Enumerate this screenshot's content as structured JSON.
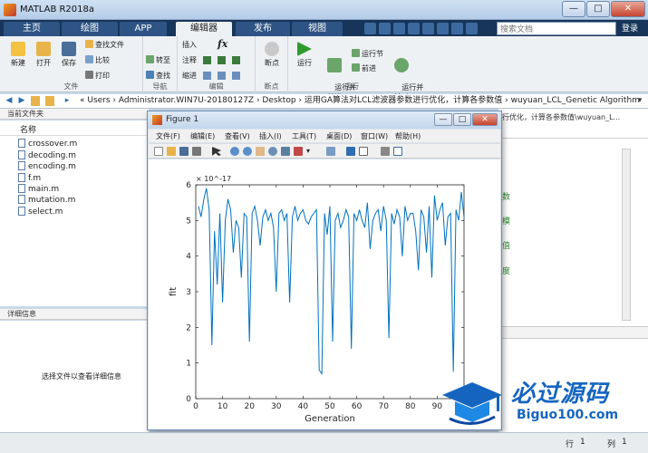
{
  "window": {
    "title": "MATLAB R2018a",
    "minimize": "—",
    "maximize": "□",
    "close": "✕"
  },
  "tabs": [
    "主页",
    "绘图",
    "APP",
    "编辑器",
    "发布",
    "视图"
  ],
  "active_tab": "编辑器",
  "search": {
    "placeholder": "搜索文档"
  },
  "login_label": "登录",
  "ribbon": {
    "file_group": {
      "label": "文件",
      "new": "新建",
      "open": "打开",
      "save": "保存",
      "find_files": "查找文件",
      "compare": "比较",
      "print": "打印"
    },
    "nav_group": {
      "label": "导航",
      "goto": "转至",
      "find": "查找"
    },
    "edit_group": {
      "label": "编辑",
      "insert": "插入",
      "comment": "注释",
      "indent": "缩进",
      "fx": "fx"
    },
    "breakpoint_group": {
      "label": "断点",
      "breakpoint": "断点"
    },
    "run_group": {
      "label": "运行",
      "run": "运行",
      "run_advance": "运行并\n前进",
      "run_section": "运行节",
      "advance": "前进",
      "run_time": "运行并\n计时"
    }
  },
  "address": {
    "path": "«  Users  ›  Administrator.WIN7U-20180127Z  ›  Desktop  ›  运用GA算法对LCL滤波器参数进行优化，计算各参数值  ›  wuyuan_LCL_Genetic Algorithm"
  },
  "file_browser": {
    "header": "当前文件夹",
    "column": "名称",
    "files": [
      "crossover.m",
      "decoding.m",
      "encoding.m",
      "f.m",
      "main.m",
      "mutation.m",
      "select.m"
    ]
  },
  "detail": {
    "header": "详细信息",
    "message": "选择文件以查看详细信息"
  },
  "right_panel": {
    "truncated_title": "行优化，计算各参数值\\wuyuan_L...",
    "snippets": [
      "数",
      "模",
      "值",
      "度"
    ]
  },
  "figure": {
    "title": "Figure 1",
    "menu": [
      "文件(F)",
      "编辑(E)",
      "查看(V)",
      "插入(I)",
      "工具(T)",
      "桌面(D)",
      "窗口(W)",
      "帮助(H)"
    ]
  },
  "status_bar": {
    "row_label": "行",
    "row_value": "1",
    "col_label": "列",
    "col_value": "1"
  },
  "watermark": {
    "text": "必过源码",
    "url": "Biguo100.com"
  },
  "chart_data": {
    "type": "line",
    "xlabel": "Generation",
    "ylabel": "fit",
    "exponent_label": "× 10^-17",
    "xlim": [
      0,
      100
    ],
    "ylim": [
      0,
      6
    ],
    "xticks": [
      0,
      10,
      20,
      30,
      40,
      50,
      60,
      70,
      80,
      90
    ],
    "yticks": [
      0,
      1,
      2,
      3,
      4,
      5,
      6
    ],
    "color": "#0072BD",
    "series": [
      {
        "values": [
          5.4,
          5.1,
          5.6,
          5.9,
          5.3,
          1.5,
          4.7,
          3.2,
          5.2,
          2.7,
          5.0,
          5.6,
          5.3,
          4.1,
          5.0,
          4.8,
          3.4,
          5.2,
          5.1,
          1.6,
          5.2,
          5.4,
          5.0,
          4.3,
          5.1,
          5.3,
          5.0,
          5.2,
          4.8,
          3.0,
          5.2,
          5.3,
          5.0,
          5.2,
          2.7,
          5.1,
          5.4,
          5.0,
          5.2,
          5.3,
          5.0,
          4.9,
          5.1,
          5.2,
          5.3,
          0.8,
          0.7,
          5.2,
          4.6,
          5.4,
          1.6,
          5.0,
          5.2,
          4.8,
          5.0,
          5.3,
          5.1,
          1.4,
          5.2,
          5.0,
          5.3,
          5.0,
          4.8,
          5.5,
          4.2,
          5.0,
          5.2,
          5.3,
          4.7,
          5.4,
          5.0,
          1.7,
          5.2,
          4.9,
          5.3,
          5.1,
          4.0,
          5.4,
          5.0,
          5.2,
          5.2,
          4.7,
          3.6,
          5.3,
          5.1,
          4.1,
          5.4,
          3.4,
          5.7,
          5.0,
          5.3,
          5.5,
          4.3,
          5.1,
          5.2,
          0.75,
          5.3,
          5.0,
          5.8,
          5.1
        ]
      }
    ]
  }
}
